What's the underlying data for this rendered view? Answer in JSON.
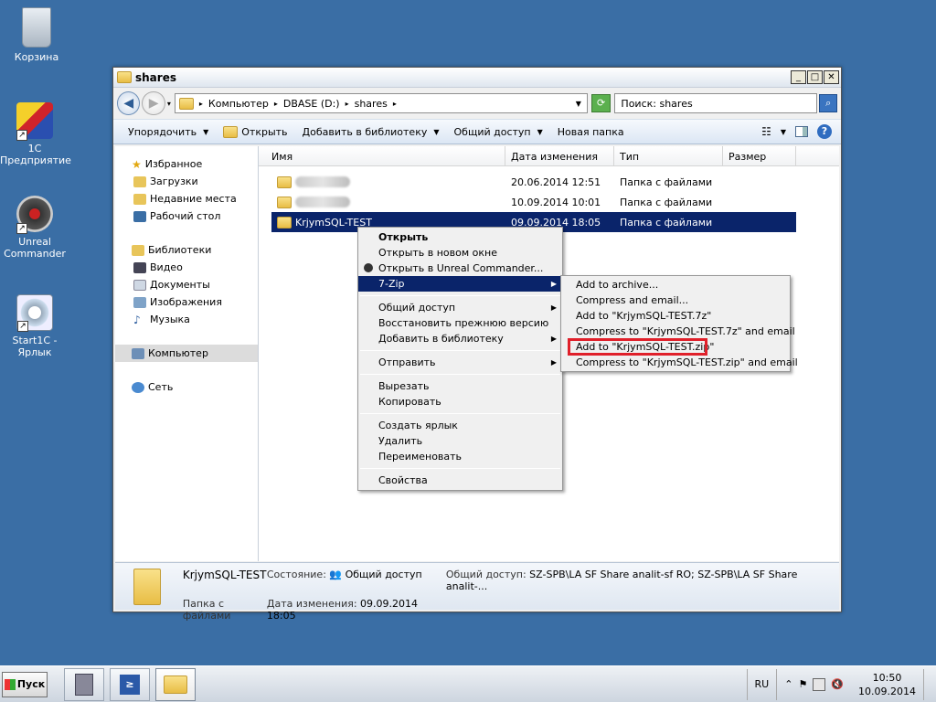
{
  "desktop": {
    "icons": [
      {
        "label": "Корзина",
        "icon": "recycle-bin-icon"
      },
      {
        "label": "1С Предприятие",
        "icon": "1c-icon"
      },
      {
        "label": "Unreal Commander",
        "icon": "unreal-commander-icon"
      },
      {
        "label": "Start1C - Ярлык",
        "icon": "start1c-icon"
      }
    ]
  },
  "window": {
    "title": "shares",
    "address": {
      "seg1": "Компьютер",
      "seg2": "DBASE (D:)",
      "seg3": "shares"
    },
    "search_placeholder": "Поиск: shares",
    "toolbar": {
      "organize": "Упорядочить",
      "open": "Открыть",
      "add_to_library": "Добавить в библиотеку",
      "share": "Общий доступ",
      "new_folder": "Новая папка"
    },
    "nav": {
      "favorites": "Избранное",
      "downloads": "Загрузки",
      "recent": "Недавние места",
      "desktop": "Рабочий стол",
      "libraries": "Библиотеки",
      "video": "Видео",
      "documents": "Документы",
      "images": "Изображения",
      "music": "Музыка",
      "computer": "Компьютер",
      "network": "Сеть"
    },
    "columns": {
      "name": "Имя",
      "date": "Дата изменения",
      "type": "Тип",
      "size": "Размер"
    },
    "files": [
      {
        "name": "",
        "date": "20.06.2014 12:51",
        "type": "Папка с файлами"
      },
      {
        "name": "",
        "date": "10.09.2014 10:01",
        "type": "Папка с файлами"
      },
      {
        "name": "KrjymSQL-TEST",
        "date": "09.09.2014 18:05",
        "type": "Папка с файлами"
      }
    ],
    "details": {
      "name": "KrjymSQL-TEST",
      "type": "Папка с файлами",
      "state_label": "Состояние:",
      "state_value": "Общий доступ",
      "date_label": "Дата изменения:",
      "date_value": "09.09.2014 18:05",
      "share_label": "Общий доступ:",
      "share_value": "SZ-SPB\\LA SF Share analit-sf RO; SZ-SPB\\LA SF Share analit-..."
    }
  },
  "context_menu": {
    "open": "Открыть",
    "open_new": "Открыть в новом окне",
    "open_unreal": "Открыть в Unreal Commander...",
    "zip": "7-Zip",
    "share": "Общий доступ",
    "restore": "Восстановить прежнюю версию",
    "add_library": "Добавить в библиотеку",
    "send_to": "Отправить",
    "cut": "Вырезать",
    "copy": "Копировать",
    "shortcut": "Создать ярлык",
    "delete": "Удалить",
    "rename": "Переименовать",
    "properties": "Свойства"
  },
  "zip_submenu": {
    "add_archive": "Add to archive...",
    "compress_email": "Compress and email...",
    "add_7z": "Add to \"KrjymSQL-TEST.7z\"",
    "compress_7z_email": "Compress to \"KrjymSQL-TEST.7z\" and email",
    "add_zip": "Add to \"KrjymSQL-TEST.zip\"",
    "compress_zip_email": "Compress to \"KrjymSQL-TEST.zip\" and email"
  },
  "taskbar": {
    "start": "Пуск",
    "lang": "RU",
    "time": "10:50",
    "date": "10.09.2014"
  },
  "colors": {
    "highlight": "#0a246a",
    "desktop": "#3a6ea5",
    "annotation": "#e0202a"
  }
}
